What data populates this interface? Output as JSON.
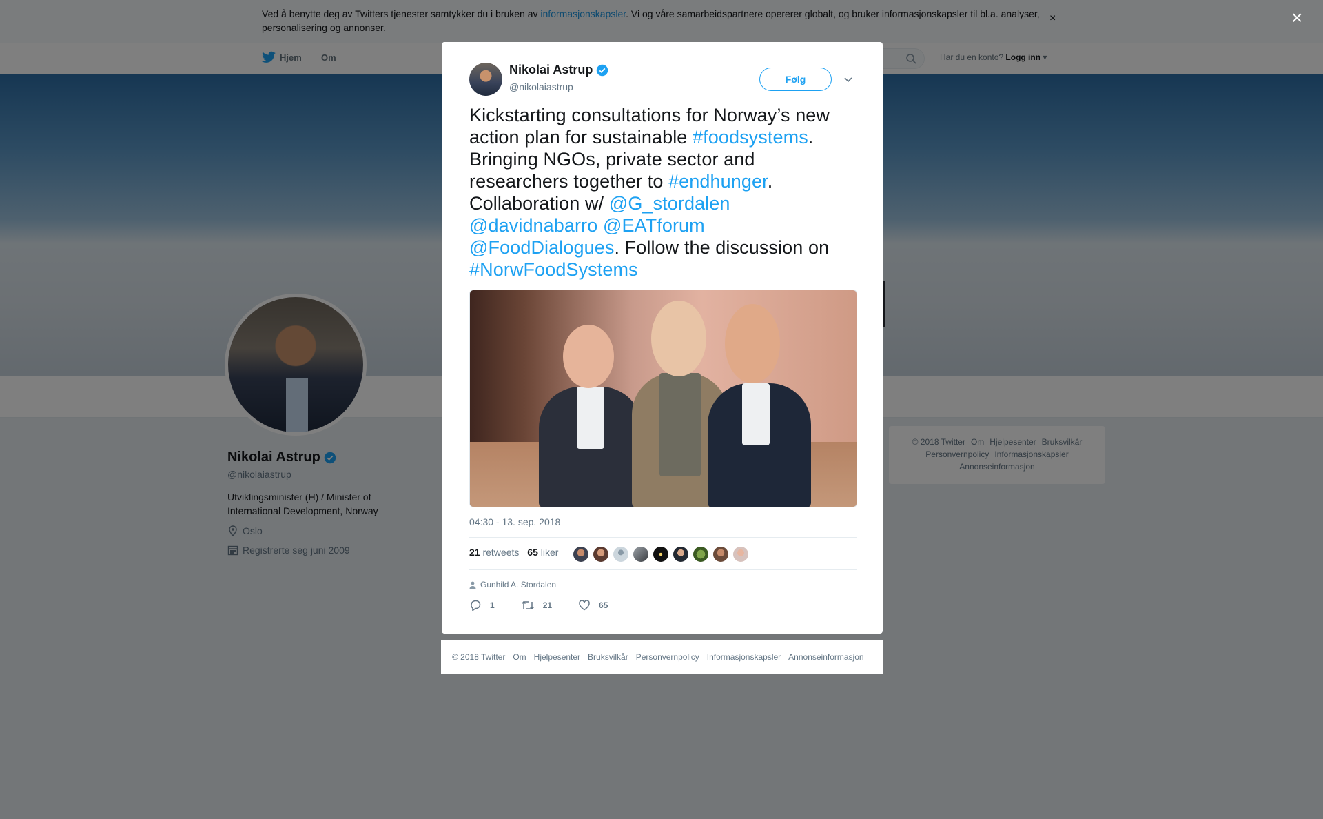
{
  "cookie": {
    "text_before": "Ved å benytte deg av Twitters tjenester samtykker du i bruken av ",
    "link": "informasjonskapsler",
    "text_after": ". Vi og våre samarbeidspartnere opererer globalt, og bruker informasjonskapsler til bl.a. analyser, personalisering og annonser.",
    "close": "×"
  },
  "nav": {
    "home": "Hjem",
    "about": "Om",
    "login_prompt": "Har du en konto?",
    "login": "Logg inn"
  },
  "profile": {
    "name": "Nikolai Astrup",
    "handle": "@nikolaiastrup",
    "bio": "Utviklingsminister (H) / Minister of International Development, Norway",
    "location": "Oslo",
    "joined": "Registrerte seg juni 2009"
  },
  "side_footer": {
    "row1": [
      "© 2018 Twitter",
      "Om",
      "Hjelpesenter",
      "Bruksvilkår"
    ],
    "row2": [
      "Personvernpolicy",
      "Informasjonskapsler"
    ],
    "row3": [
      "Annonseinformasjon"
    ]
  },
  "overlay": {
    "close": "×"
  },
  "tweet": {
    "name": "Nikolai Astrup",
    "handle": "@nikolaiastrup",
    "follow": "Følg",
    "text": {
      "t1": "Kickstarting consultations for Norway’s new action plan for sustainable ",
      "h1": "#foodsystems",
      "t2": ". Bringing NGOs, private sector and researchers together to ",
      "h2": "#endhunger",
      "t3": ". Collaboration w/ ",
      "m1": "@G_stordalen",
      "m2": "@davidnabarro",
      "m3": "@EATforum",
      "m4": "@FoodDialogues",
      "t4": ". Follow the discussion on ",
      "h3": "#NorwFoodSystems"
    },
    "timestamp": "04:30 - 13. sep. 2018",
    "retweets_count": "21",
    "retweets_label": "retweets",
    "likes_count": "65",
    "likes_label": "liker",
    "reply_to": "Gunhild A. Stordalen",
    "replies": "1",
    "retweets": "21",
    "likes": "65"
  },
  "modal_footer": [
    "© 2018 Twitter",
    "Om",
    "Hjelpesenter",
    "Bruksvilkår",
    "Personvernpolicy",
    "Informasjonskapsler",
    "Annonseinformasjon"
  ],
  "colors": {
    "accent": "#1da1f2",
    "link": "#1b95e0",
    "muted": "#657786",
    "overlay": "rgba(0,0,0,0.5)"
  },
  "icons": [
    "twitter-bird-icon",
    "search-icon",
    "verified-badge-icon",
    "chevron-down-icon",
    "location-pin-icon",
    "calendar-icon",
    "person-icon",
    "reply-icon",
    "retweet-icon",
    "heart-icon",
    "close-icon"
  ]
}
